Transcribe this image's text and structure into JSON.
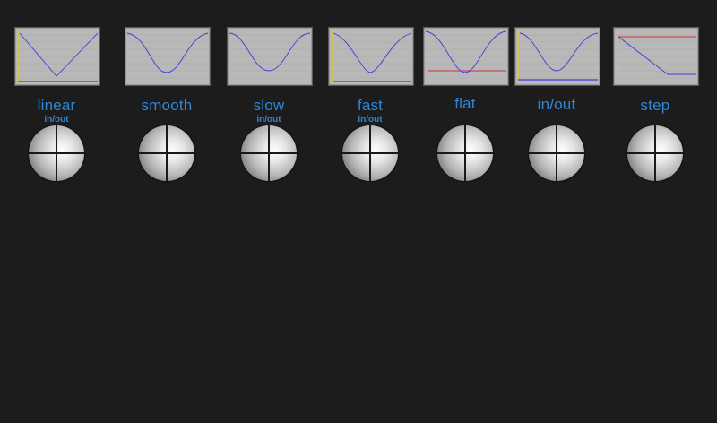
{
  "presets": [
    {
      "id": "linear",
      "label": "linear",
      "sublabel": "in/out",
      "curve_points": [
        [
          0,
          0.05
        ],
        [
          0.5,
          0.85
        ],
        [
          1,
          0.05
        ]
      ],
      "mode": "linear"
    },
    {
      "id": "smooth",
      "label": "smooth",
      "sublabel": "",
      "mode": "smooth"
    },
    {
      "id": "slow",
      "label": "slow",
      "sublabel": "in/out",
      "mode": "slow"
    },
    {
      "id": "fast",
      "label": "fast",
      "sublabel": "in/out",
      "mode": "fast"
    },
    {
      "id": "flat",
      "label": "flat",
      "sublabel": "",
      "mode": "flat"
    },
    {
      "id": "inout",
      "label": "in/out",
      "sublabel": "",
      "mode": "inout"
    },
    {
      "id": "step",
      "label": "step",
      "sublabel": "",
      "mode": "step"
    }
  ],
  "colors": {
    "curve": "#3b3bd8",
    "marker_red": "#d03030",
    "marker_yellow": "#e6d200",
    "label": "#2f86d6"
  },
  "icons": {
    "ball": "crosshair-sphere-icon"
  }
}
